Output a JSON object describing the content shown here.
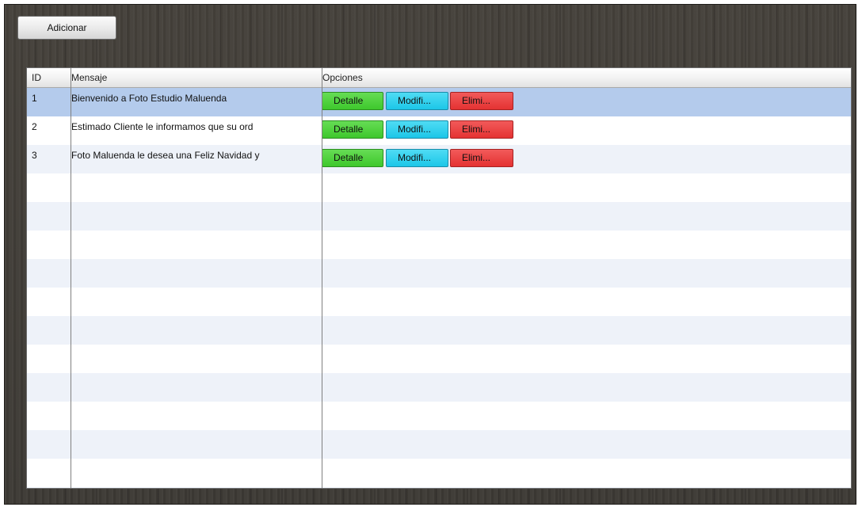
{
  "toolbar": {
    "add_label": "Adicionar"
  },
  "table": {
    "headers": {
      "id": "ID",
      "message": "Mensaje",
      "options": "Opciones"
    },
    "rows": [
      {
        "id": "1",
        "message": "Bienvenido a Foto Estudio Maluenda"
      },
      {
        "id": "2",
        "message": "Estimado Cliente le informamos que su ord"
      },
      {
        "id": "3",
        "message": "Foto Maluenda le desea una Feliz Navidad y"
      }
    ],
    "selected_row": 1,
    "actions": {
      "detail": "Detalle",
      "modify": "Modifi...",
      "delete": "Elimi..."
    }
  },
  "colors": {
    "detail": "#3ec82c",
    "modify": "#1cc6e8",
    "delete": "#e43232",
    "selection": "#b4cbec",
    "alt_row": "#eef2f9",
    "background": "#3f3b36"
  }
}
